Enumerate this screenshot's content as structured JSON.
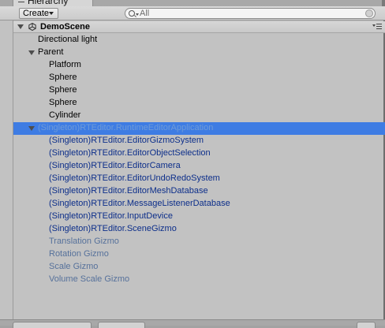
{
  "panel": {
    "tab_label": "Hierarchy"
  },
  "toolbar": {
    "create_label": "Create",
    "search_placeholder": "All",
    "search_value": ""
  },
  "scene": {
    "name": "DemoScene"
  },
  "items": [
    {
      "label": "Directional light",
      "style": "black",
      "indent": 0,
      "fold": "none"
    },
    {
      "label": "Parent",
      "style": "black",
      "indent": 0,
      "fold": "open"
    },
    {
      "label": "Platform",
      "style": "black",
      "indent": 1,
      "fold": "none"
    },
    {
      "label": "Sphere",
      "style": "black",
      "indent": 1,
      "fold": "none"
    },
    {
      "label": "Sphere",
      "style": "black",
      "indent": 1,
      "fold": "none"
    },
    {
      "label": "Sphere",
      "style": "black",
      "indent": 1,
      "fold": "none"
    },
    {
      "label": "Cylinder",
      "style": "black",
      "indent": 1,
      "fold": "none"
    },
    {
      "label": "(Singleton)RTEditor.RuntimeEditorApplication",
      "style": "selected",
      "indent": 0,
      "fold": "open"
    },
    {
      "label": "(Singleton)RTEditor.EditorGizmoSystem",
      "style": "blue",
      "indent": 1,
      "fold": "none"
    },
    {
      "label": "(Singleton)RTEditor.EditorObjectSelection",
      "style": "blue",
      "indent": 1,
      "fold": "none"
    },
    {
      "label": "(Singleton)RTEditor.EditorCamera",
      "style": "blue",
      "indent": 1,
      "fold": "none"
    },
    {
      "label": "(Singleton)RTEditor.EditorUndoRedoSystem",
      "style": "blue",
      "indent": 1,
      "fold": "none"
    },
    {
      "label": "(Singleton)RTEditor.EditorMeshDatabase",
      "style": "blue",
      "indent": 1,
      "fold": "none"
    },
    {
      "label": "(Singleton)RTEditor.MessageListenerDatabase",
      "style": "blue",
      "indent": 1,
      "fold": "none"
    },
    {
      "label": "(Singleton)RTEditor.InputDevice",
      "style": "blue",
      "indent": 1,
      "fold": "none"
    },
    {
      "label": "(Singleton)RTEditor.SceneGizmo",
      "style": "blue",
      "indent": 1,
      "fold": "none"
    },
    {
      "label": "Translation Gizmo",
      "style": "gray",
      "indent": 1,
      "fold": "none"
    },
    {
      "label": "Rotation Gizmo",
      "style": "gray",
      "indent": 1,
      "fold": "none"
    },
    {
      "label": "Scale Gizmo",
      "style": "gray",
      "indent": 1,
      "fold": "none"
    },
    {
      "label": "Volume Scale Gizmo",
      "style": "gray",
      "indent": 1,
      "fold": "none"
    }
  ],
  "colors": {
    "selection": "#3e7ce3",
    "prefab_text": "#0c2e8a",
    "inactive_prefab_text": "#56719b"
  }
}
